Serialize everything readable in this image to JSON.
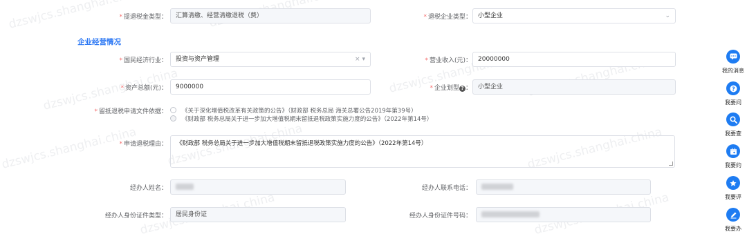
{
  "form": {
    "refund_type": {
      "label": "提退税金类型：",
      "value": "汇算清缴、经营清缴退税（费）"
    },
    "enterprise_type": {
      "label": "退税企业类型：",
      "value": "小型企业"
    },
    "section_title": "企业经营情况",
    "industry": {
      "label": "国民经济行业：",
      "value": "投资与资产管理",
      "clear": "×",
      "arrow": "▾"
    },
    "revenue": {
      "label": "营业收入(元)：",
      "value": "20000000"
    },
    "total_assets": {
      "label": "资产总额(元)：",
      "value": "9000000"
    },
    "enterprise_scale": {
      "label": "企业划型",
      "help": "?",
      "colon": "：",
      "value": "小型企业"
    },
    "policy_basis": {
      "label": "留抵退税申请文件依据：",
      "options": [
        "《关于深化增值税改革有关政策的公告》（财政部 税务总局 海关总署公告2019年第39号）",
        "《财政部 税务总局关于进一步加大增值税期末留抵退税政策实施力度的公告》（2022年第14号）"
      ],
      "selected_index": 1
    },
    "refund_reason": {
      "label": "申请退税理由：",
      "value": "《财政部 税务总局关于进一步加大增值税期末留抵退税政策实施力度的公告》（2022年第14号）"
    },
    "handler_name": {
      "label": "经办人姓名："
    },
    "handler_phone": {
      "label": "经办人联系电话："
    },
    "handler_id_type": {
      "label": "经办人身份证件类型：",
      "value": "居民身份证"
    },
    "handler_id_number": {
      "label": "经办人身份证件号码："
    }
  },
  "side_toolbar": [
    {
      "label": "我的消息",
      "icon": "message-icon"
    },
    {
      "label": "我要问",
      "icon": "question-icon"
    },
    {
      "label": "我要查",
      "icon": "search-icon"
    },
    {
      "label": "我要约",
      "icon": "calendar-icon"
    },
    {
      "label": "我要评",
      "icon": "rating-icon"
    },
    {
      "label": "我要办",
      "icon": "edit-icon"
    }
  ],
  "watermark": "dzswjcs.shanghai.china",
  "colors": {
    "accent": "#1e7cf2",
    "section": "#2d78f4",
    "required": "#f56c6c"
  }
}
